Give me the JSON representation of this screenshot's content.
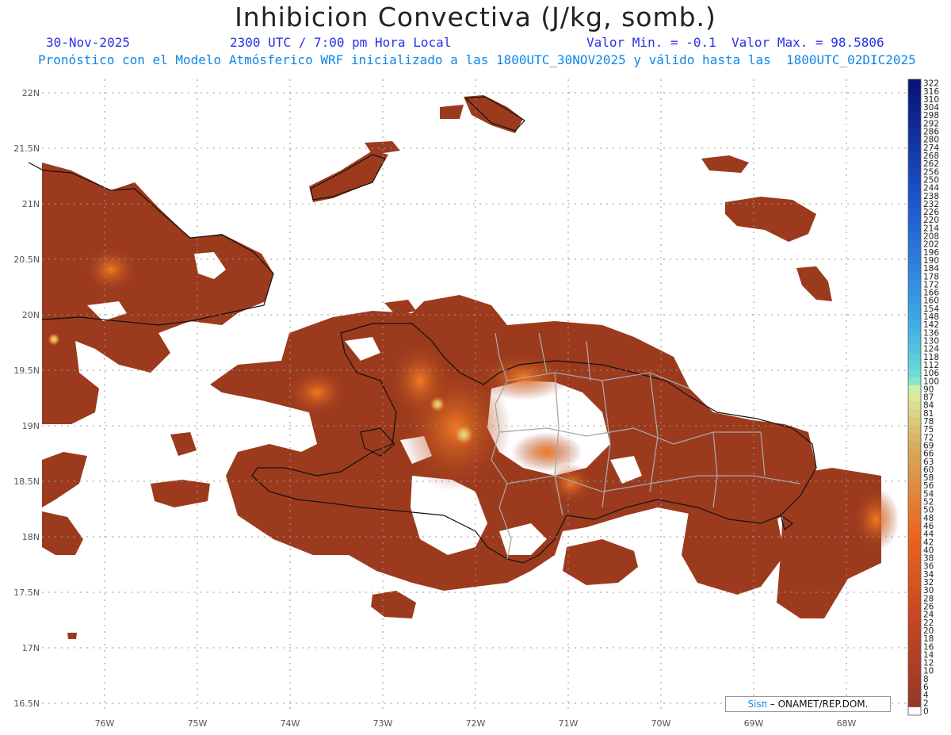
{
  "header": {
    "title": "Inhibicion Convectiva (J/kg, somb.)",
    "date": "30-Nov-2025",
    "time": "2300 UTC / 7:00 pm Hora Local",
    "minmax": "Valor Min. = -0.1  Valor Max. = 98.5806",
    "model_line": "Pronóstico con el Modelo Atmósferico WRF inicializado a las 1800UTC_30NOV2025 y válido hasta las  1800UTC_02DIC2025"
  },
  "map": {
    "lat_labels": [
      "22N",
      "21.5N",
      "21N",
      "20.5N",
      "20N",
      "19.5N",
      "19N",
      "18.5N",
      "18N",
      "17.5N",
      "17N",
      "16.5N"
    ],
    "lon_labels": [
      "76W",
      "75W",
      "74W",
      "73W",
      "72W",
      "71W",
      "70W",
      "69W",
      "68W"
    ],
    "colors": {
      "land_cin": "#9c3a1e",
      "high_cin": "#ea5a14",
      "peak_cin": "#cfe8a0",
      "zero": "#ffffff",
      "coast": "#111111",
      "provinces": "#a7a7a7"
    }
  },
  "colorbar": {
    "labels": [
      "322",
      "316",
      "310",
      "304",
      "298",
      "292",
      "286",
      "280",
      "274",
      "268",
      "262",
      "256",
      "250",
      "244",
      "238",
      "232",
      "226",
      "220",
      "214",
      "208",
      "202",
      "196",
      "190",
      "184",
      "178",
      "172",
      "166",
      "160",
      "154",
      "148",
      "142",
      "136",
      "130",
      "124",
      "118",
      "112",
      "106",
      "100",
      "90",
      "87",
      "84",
      "81",
      "78",
      "75",
      "72",
      "69",
      "66",
      "63",
      "60",
      "58",
      "56",
      "54",
      "52",
      "50",
      "48",
      "46",
      "44",
      "42",
      "40",
      "38",
      "36",
      "34",
      "32",
      "30",
      "28",
      "26",
      "24",
      "22",
      "20",
      "18",
      "16",
      "14",
      "12",
      "10",
      "8",
      "6",
      "4",
      "2",
      "0"
    ]
  },
  "credit": {
    "brand": "Sisπ",
    "text": "– ONAMET/REP.DOM."
  }
}
